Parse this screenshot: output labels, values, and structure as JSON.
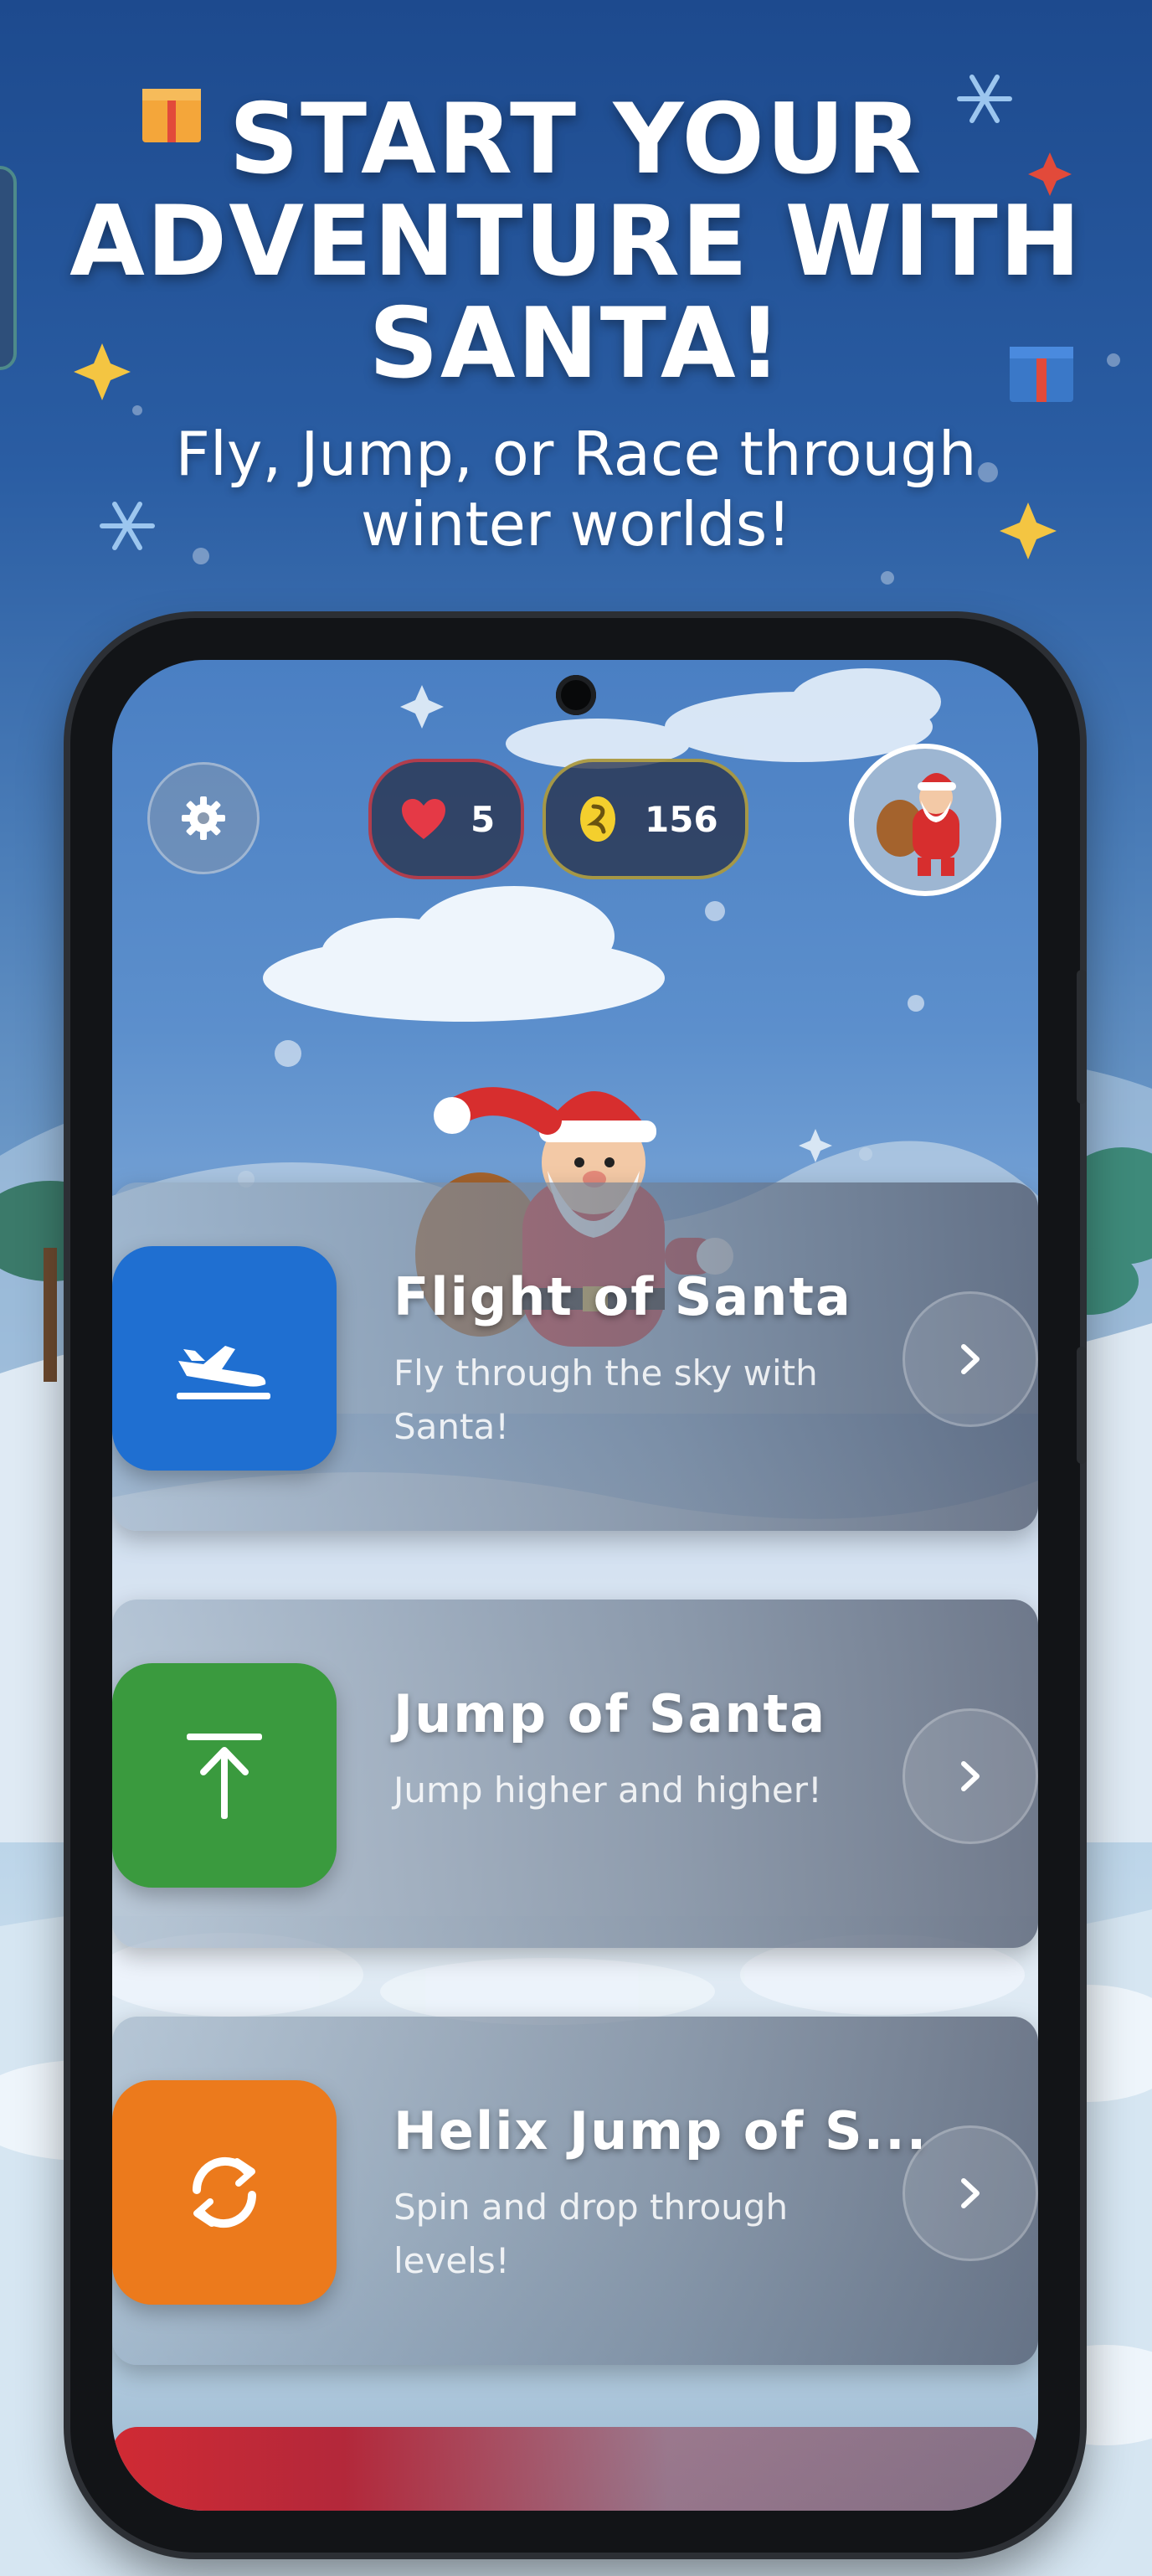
{
  "promo": {
    "headline": [
      "START YOUR",
      "ADVENTURE WITH",
      "SANTA!"
    ],
    "subheadline": [
      "Fly, Jump, or Race through",
      "winter worlds!"
    ]
  },
  "hud": {
    "lives": "5",
    "coins": "156",
    "settings_icon": "gear-icon",
    "lives_icon": "heart-icon",
    "coins_icon": "coin-icon"
  },
  "games": [
    {
      "title": "Flight of Santa",
      "description": "Fly through the sky with Santa!",
      "icon": "airplane-takeoff-icon",
      "color": "#1f6fd1"
    },
    {
      "title": "Jump of Santa",
      "description": "Jump higher and higher!",
      "icon": "arrow-up-to-line-icon",
      "color": "#3a9a3e"
    },
    {
      "title": "Helix Jump of S...",
      "description": "Spin and drop through levels!",
      "icon": "sync-arrows-icon",
      "color": "#ec7a1c"
    }
  ],
  "colors": {
    "heart": "#e53946",
    "coin": "#f4cf2d",
    "peek_card": "#d02a34"
  }
}
